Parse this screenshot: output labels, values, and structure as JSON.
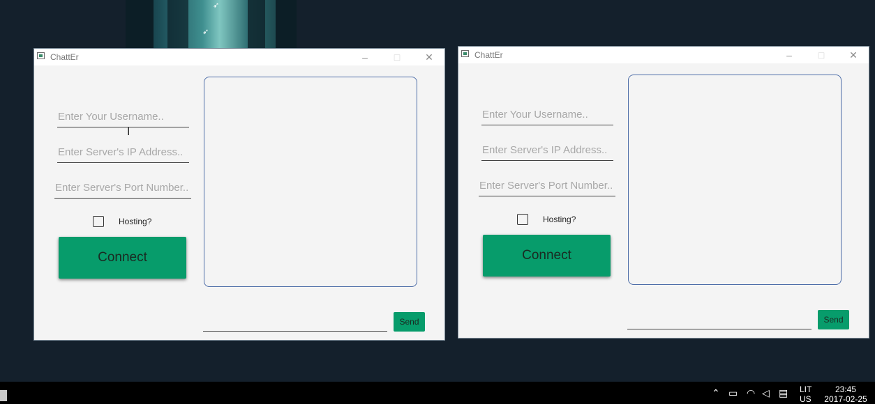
{
  "windows": [
    {
      "title": "ChattEr",
      "username_placeholder": "Enter Your Username..",
      "ip_placeholder": "Enter Server's IP Address..",
      "port_placeholder": "Enter Server's Port Number..",
      "hosting_label": "Hosting?",
      "hosting_checked": false,
      "connect_label": "Connect",
      "send_label": "Send",
      "message_value": ""
    },
    {
      "title": "ChattEr",
      "username_placeholder": "Enter Your Username..",
      "ip_placeholder": "Enter Server's IP Address..",
      "port_placeholder": "Enter Server's Port Number..",
      "hosting_label": "Hosting?",
      "hosting_checked": false,
      "connect_label": "Connect",
      "send_label": "Send",
      "message_value": ""
    }
  ],
  "taskbar": {
    "lang_line1": "LIT",
    "lang_line2": "US",
    "time": "23:45",
    "date": "2017-02-25",
    "tray_icons": [
      "chevron-up-icon",
      "battery-icon",
      "wifi-icon",
      "volume-icon",
      "notification-icon"
    ]
  },
  "colors": {
    "accent": "#079c6b",
    "desktop": "#14202c",
    "window_bg": "#f4f4f4",
    "chat_border": "#4d6da8"
  }
}
